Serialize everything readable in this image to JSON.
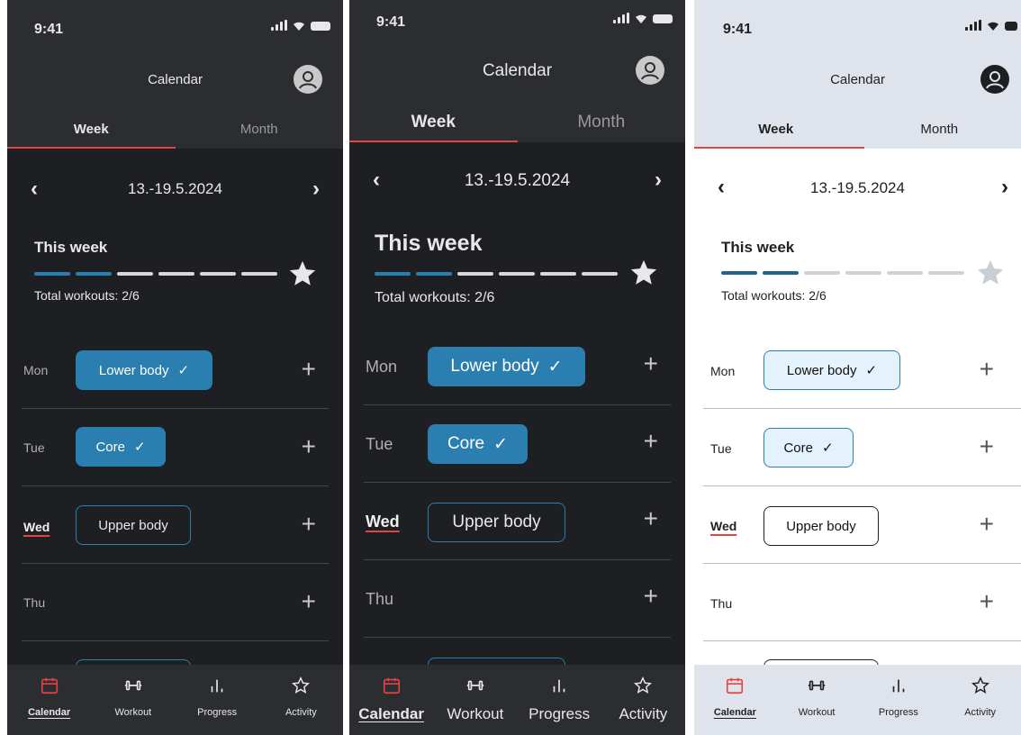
{
  "colors": {
    "accent_red": "#e04444",
    "accent_blue": "#2b7fb0",
    "progress_empty_dark": "#d9d9d9",
    "progress_empty_light": "#cfd3d8",
    "star_dark": "#e8e8e8",
    "star_light": "#c9ced4"
  },
  "status": {
    "time": "9:41"
  },
  "header": {
    "title": "Calendar",
    "avatar_icon": "user-avatar-icon"
  },
  "tabs": {
    "week": "Week",
    "month": "Month"
  },
  "week_nav": {
    "prev_icon": "chevron-left-icon",
    "next_icon": "chevron-right-icon",
    "range": "13.-19.5.2024"
  },
  "summary": {
    "heading": "This week",
    "completed": 2,
    "goal": 6,
    "total_text": "Total workouts: 2/6",
    "star_icon": "star-icon"
  },
  "days": [
    {
      "label": "Mon",
      "workout": "Lower body",
      "done": true,
      "today": false
    },
    {
      "label": "Tue",
      "workout": "Core",
      "done": true,
      "today": false
    },
    {
      "label": "Wed",
      "workout": "Upper body",
      "done": false,
      "today": true
    },
    {
      "label": "Thu",
      "workout": "",
      "done": false,
      "today": false
    }
  ],
  "bottom_nav": [
    {
      "label": "Calendar",
      "icon": "calendar-icon",
      "active": true
    },
    {
      "label": "Workout",
      "icon": "dumbbell-icon",
      "active": false
    },
    {
      "label": "Progress",
      "icon": "bar-chart-icon",
      "active": false
    },
    {
      "label": "Activity",
      "icon": "star-outline-icon",
      "active": false
    }
  ]
}
